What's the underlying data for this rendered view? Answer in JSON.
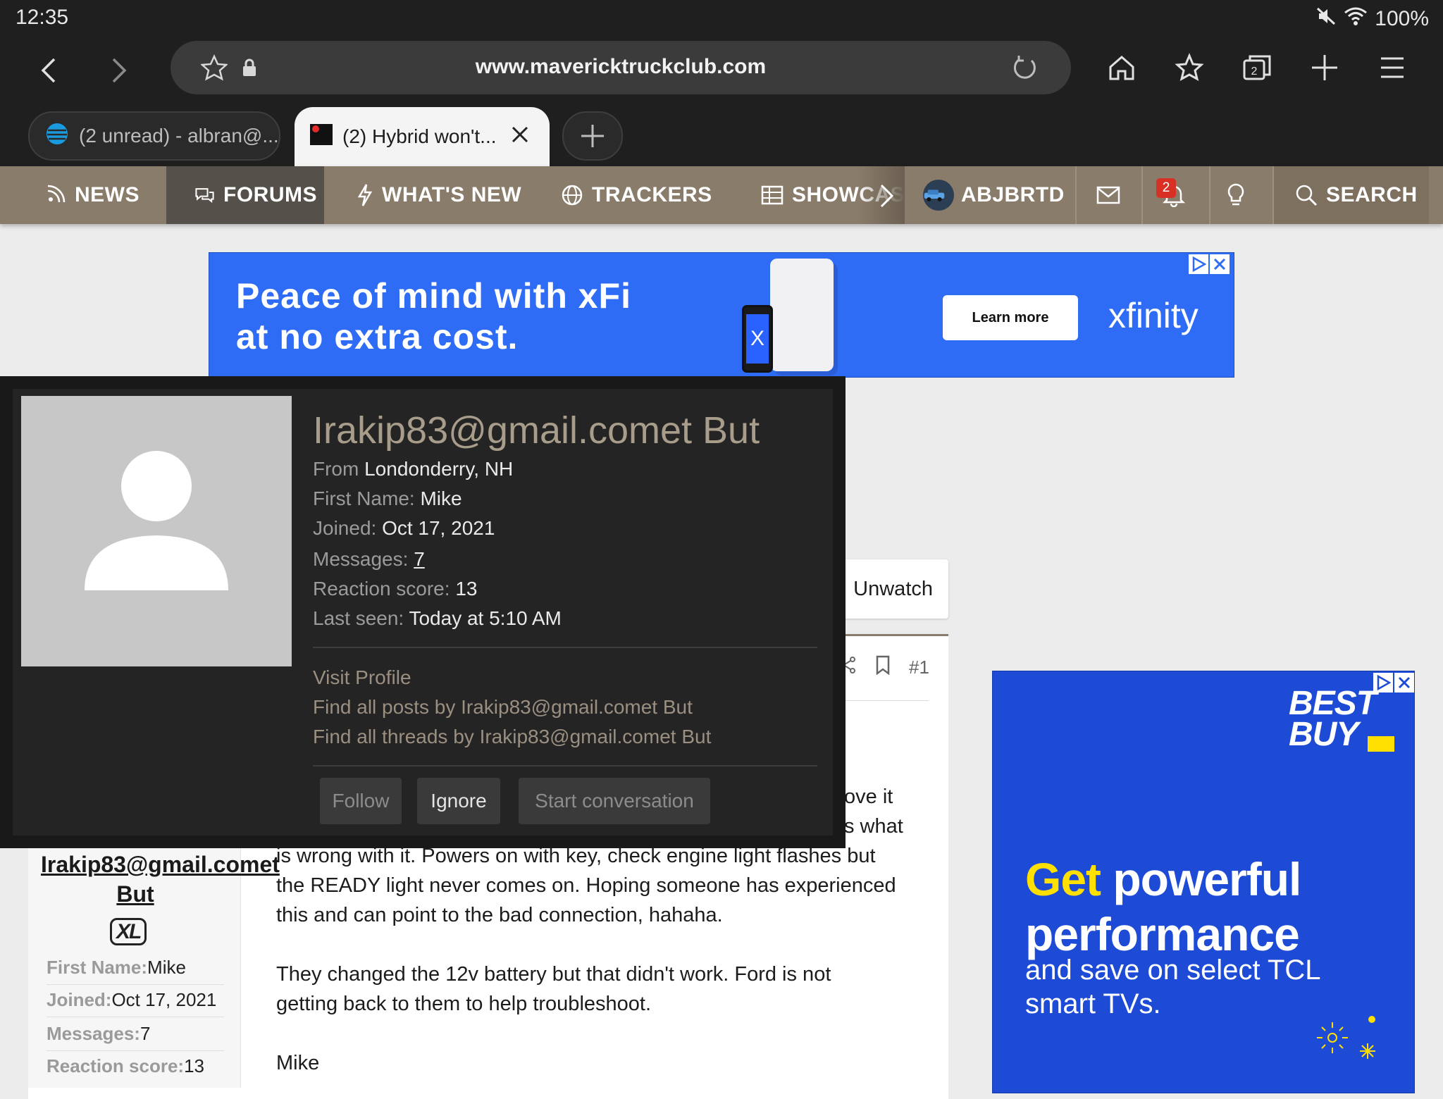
{
  "status": {
    "time": "12:35",
    "battery": "100%"
  },
  "browser": {
    "url": "www.mavericktruckclub.com",
    "tabs": [
      {
        "title": "(2 unread) - albran@..."
      },
      {
        "title": "(2) Hybrid won't..."
      }
    ]
  },
  "nav": {
    "items": [
      "NEWS",
      "FORUMS",
      "WHAT'S NEW",
      "TRACKERS",
      "SHOWCAS"
    ],
    "user": "ABJBRTD",
    "notification_count": "2",
    "search": "SEARCH"
  },
  "ad_top": {
    "line1": "Peace of mind with xFi",
    "line2": "at no extra cost.",
    "button": "Learn more",
    "brand": "xfinity",
    "phone_glyph": "X"
  },
  "thread": {
    "unwatch": "Unwatch",
    "post_number": "#1",
    "body_partial_1": "ove it",
    "body_partial_2": "s what",
    "body_line3": "is wrong with it. Powers on with key, check engine light flashes but",
    "body_line4": "the READY light never comes on. Hoping someone has experienced",
    "body_line5": "this and can point to the bad connection, hahaha.",
    "paragraph2": "They changed the 12v battery but that didn't work. Ford is not getting back to them to help troubleshoot.",
    "signature": "Mike"
  },
  "post_user": {
    "name": "Irakip83@gmail.comet But",
    "rank": "XL",
    "stats": [
      {
        "k": "First Name:",
        "v": "Mike"
      },
      {
        "k": "Joined:",
        "v": "Oct 17, 2021"
      },
      {
        "k": "Messages:",
        "v": "7"
      },
      {
        "k": "Reaction score:",
        "v": "13"
      }
    ]
  },
  "ad_side": {
    "logo_line1": "BEST",
    "logo_line2": "BUY",
    "head_get": "Get",
    "head_rest1": " powerful",
    "head_line2": "performance",
    "sub": "and save on select TCL smart TVs."
  },
  "popup": {
    "name": "Irakip83@gmail.comet But",
    "from_label": "From",
    "from": "Londonderry, NH",
    "first_name_label": "First Name:",
    "first_name": "Mike",
    "joined_label": "Joined:",
    "joined": "Oct 17, 2021",
    "messages_label": "Messages:",
    "messages": "7",
    "reaction_label": "Reaction score:",
    "reaction": "13",
    "last_seen_label": "Last seen:",
    "last_seen": "Today at 5:10 AM",
    "visit_profile": "Visit Profile",
    "find_posts": "Find all posts by Irakip83@gmail.comet But",
    "find_threads": "Find all threads by Irakip83@gmail.comet But",
    "btn_follow": "Follow",
    "btn_ignore": "Ignore",
    "btn_start": "Start conversation"
  },
  "colors": {
    "nav_bg": "#8a7c6a",
    "popup_bg": "#242424",
    "ad_blue": "#2f6cf5",
    "bestbuy_blue": "#1d4bd6",
    "bestbuy_yellow": "#ffe000"
  }
}
